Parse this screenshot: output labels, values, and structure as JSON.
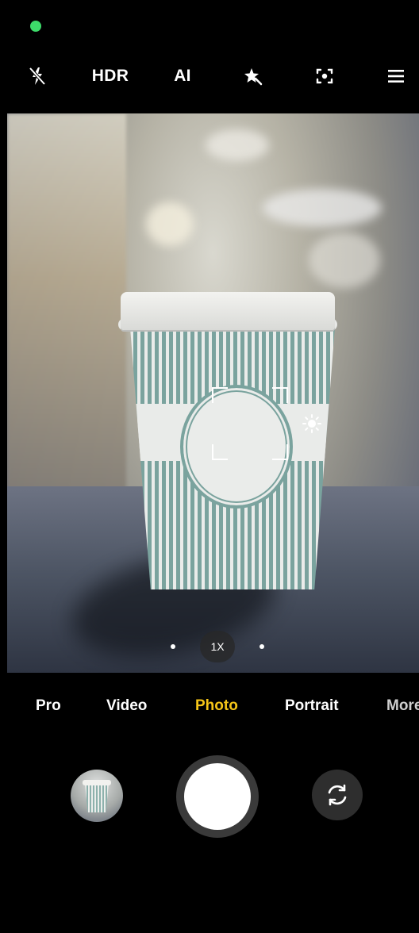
{
  "status_bar": {
    "indicator_color": "#3ddc6a"
  },
  "toolbar": {
    "flash_icon": "flash-off-icon",
    "hdr_label": "HDR",
    "ai_label": "AI",
    "filter_icon": "magic-star-icon",
    "lens_icon": "focus-target-icon",
    "menu_icon": "hamburger-menu-icon"
  },
  "viewfinder": {
    "focus_icon": "focus-frame-icon",
    "exposure_icon": "sun-exposure-icon"
  },
  "zoom": {
    "level_label": "1X"
  },
  "modes": {
    "items": [
      "Pro",
      "Video",
      "Photo",
      "Portrait",
      "More"
    ],
    "selected": "Photo",
    "selected_color": "#f5c518"
  },
  "controls": {
    "gallery_icon": "gallery-thumbnail",
    "shutter_icon": "shutter-button",
    "switch_icon": "switch-camera-icon"
  }
}
